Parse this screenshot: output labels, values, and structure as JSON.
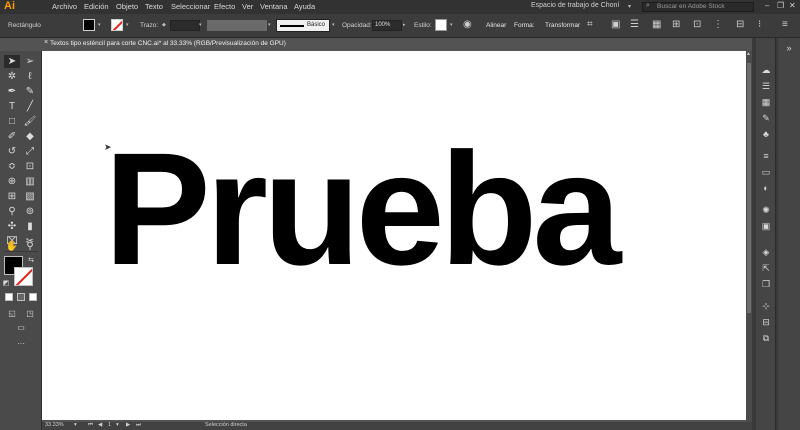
{
  "app": {
    "logo": "Ai"
  },
  "menu": [
    "Archivo",
    "Edición",
    "Objeto",
    "Texto",
    "Seleccionar",
    "Efecto",
    "Ver",
    "Ventana",
    "Ayuda"
  ],
  "workspace": {
    "label": "Espacio de trabajo de Choní"
  },
  "stock_search": {
    "placeholder": "Buscar en Adobe Stock"
  },
  "control_bar": {
    "selection_label": "Rectángulo",
    "stroke_label": "Trazo:",
    "brush_label": "Básico",
    "opacity_label": "Opacidad:",
    "opacity_value": "100%",
    "style_label": "Estilo:",
    "align_label": "Alinear",
    "shape_label": "Forma:",
    "transform_label": "Transformar",
    "fill_color": "#000000",
    "stroke_color": "none"
  },
  "document": {
    "tab_title": "Textos tipo esténcil para corte CNC.ai* al 33.33% (RGB/Previsualización de GPU)",
    "close_glyph": "×"
  },
  "canvas": {
    "text": "Prueba"
  },
  "status": {
    "zoom": "33.33%",
    "page": "1",
    "tool": "Selección directa"
  },
  "colors": {
    "menubar": "#323232",
    "controlbar": "#3c3c3c",
    "pasteboard": "#535353",
    "artboard": "#ffffff",
    "logo": "#ff9a00",
    "none_slash": "#e2231a"
  }
}
